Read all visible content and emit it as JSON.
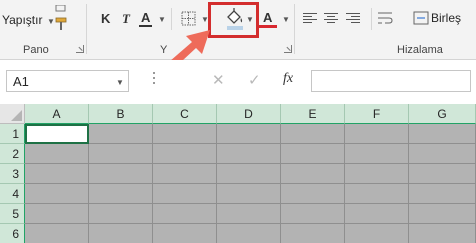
{
  "ribbon": {
    "paste_label": "Yapıştır",
    "groups": {
      "clipboard": "Pano",
      "font": "Y",
      "alignment": "Hizalama"
    },
    "font_buttons": {
      "bold": "K",
      "italic": "T",
      "underline": "A",
      "font_color": "A"
    },
    "wrap_label": "Birleş",
    "fill_color": "#b9d2e8",
    "font_color_swatch": "#d8282f",
    "highlight_color": "#d32d2d",
    "arrow_color": "#ee6b5a"
  },
  "formula_bar": {
    "name_box": "A1",
    "cancel_icon": "✕",
    "enter_icon": "✓",
    "fx_label": "fx",
    "formula": ""
  },
  "sheet": {
    "columns": [
      "A",
      "B",
      "C",
      "D",
      "E",
      "F",
      "G"
    ],
    "rows": [
      "1",
      "2",
      "3",
      "4",
      "5",
      "6"
    ],
    "active_cell": "A1",
    "filled_color": "#b3b3b3"
  }
}
